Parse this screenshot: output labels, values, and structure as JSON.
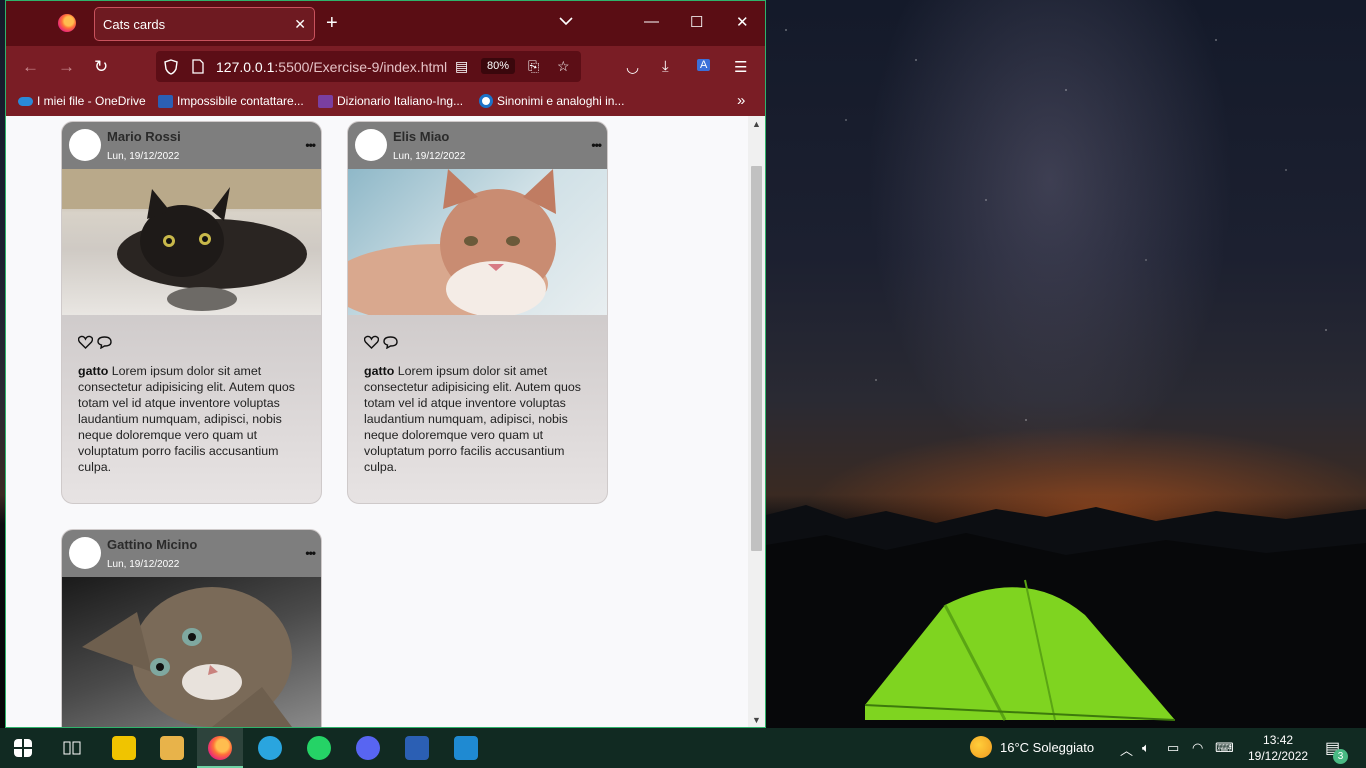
{
  "browser": {
    "tab_title": "Cats cards",
    "url_host": "127.0.0.1",
    "url_path": ":5500/Exercise-9/index.html",
    "zoom": "80%"
  },
  "bookmarks": [
    {
      "label": "I miei file - OneDrive",
      "icon": "onedrive-icon",
      "color": "#2a8ad8"
    },
    {
      "label": "Impossibile contattare...",
      "icon": "word-icon",
      "color": "#2b5fb4"
    },
    {
      "label": "Dizionario Italiano-Ing...",
      "icon": "wordreference-icon",
      "color": "#7a3fa0"
    },
    {
      "label": "Sinonimi e analoghi in...",
      "icon": "synonyms-icon",
      "color": "#1c73c9"
    }
  ],
  "cards": [
    {
      "name": "Mario Rossi",
      "date": "Lun, 19/12/2022",
      "caption_bold": "gatto",
      "caption": "Lorem ipsum dolor sit amet consectetur adipisicing elit. Autem quos totam vel id atque inventore voluptas laudantium numquam, adipisci, nobis neque doloremque vero quam ut voluptatum porro facilis accusantium culpa."
    },
    {
      "name": "Elis Miao",
      "date": "Lun, 19/12/2022",
      "caption_bold": "gatto",
      "caption": "Lorem ipsum dolor sit amet consectetur adipisicing elit. Autem quos totam vel id atque inventore voluptas laudantium numquam, adipisci, nobis neque doloremque vero quam ut voluptatum porro facilis accusantium culpa."
    },
    {
      "name": "Gattino Micino",
      "date": "Lun, 19/12/2022"
    }
  ],
  "taskbar": {
    "weather": "16°C  Soleggiato",
    "time": "13:42",
    "date": "19/12/2022",
    "notifications": "3"
  },
  "colors": {
    "titlebar": "#5a0d14",
    "toolbar": "#7a1d25",
    "taskbar": "#112a22"
  }
}
